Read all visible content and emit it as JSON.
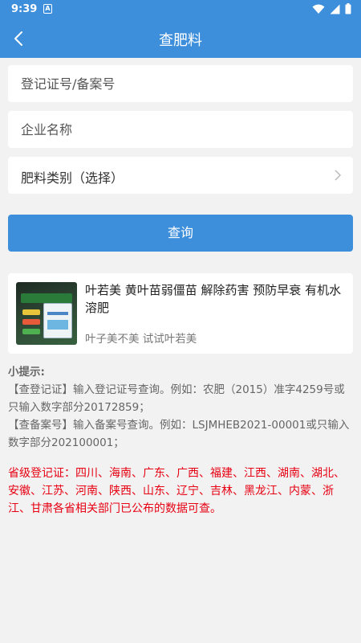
{
  "status_bar": {
    "time": "9:39",
    "notification_glyph": "A"
  },
  "app_bar": {
    "title": "查肥料",
    "back_icon": "chevron-left-icon"
  },
  "form": {
    "registration_placeholder": "登记证号/备案号",
    "company_placeholder": "企业名称",
    "category_label": "肥料类别（选择）",
    "query_button": "查询"
  },
  "ad": {
    "headline": "叶若美 黄叶苗弱僵苗 解除药害 预防早衰 有机水溶肥",
    "subtitle": "叶子美不美 试试叶若美"
  },
  "tips": {
    "title": "小提示:",
    "line1": "【查登记证】输入登记证号查询。例如：农肥（2015）准字4259号或只输入数字部分20172859；",
    "line2": "【查备案号】输入备案号查询。例如：LSJMHEB2021-00001或只输入数字部分202100001；",
    "provinces": "省级登记证：四川、海南、广东、广西、福建、江西、湖南、湖北、安徽、江苏、河南、陕西、山东、辽宁、吉林、黑龙江、内蒙、浙江、甘肃各省相关部门已公布的数据可查。"
  },
  "colors": {
    "primary": "#3d8fdc",
    "background": "#f2f2f2",
    "warning_text": "#e60012"
  }
}
